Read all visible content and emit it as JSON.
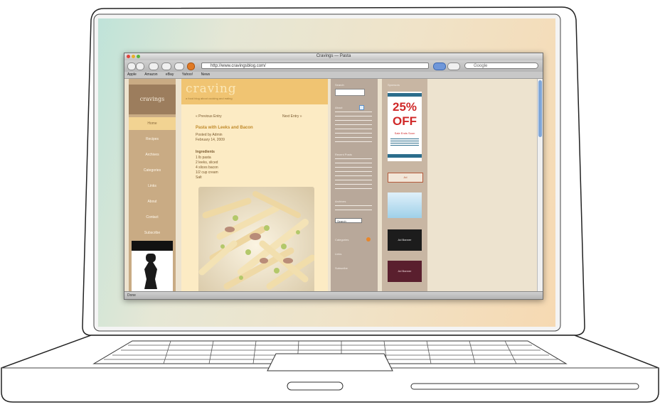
{
  "browser": {
    "window_title": "Cravings — Pasta",
    "url": "http://www.cravingsblog.com/",
    "search_placeholder": "Google",
    "bookmarks": [
      "Apple",
      "Amazon",
      "eBay",
      "Yahoo!",
      "News"
    ],
    "status": "Done"
  },
  "site": {
    "logo": "cravings",
    "brand": "craving",
    "tagline": "a food blog about cooking and eating",
    "nav": [
      "Home",
      "Recipes",
      "Archives",
      "Categories",
      "Links",
      "About",
      "Contact",
      "Subscribe"
    ],
    "breadcrumb_left": "« Previous Entry",
    "breadcrumb_right": "Next Entry »",
    "post_title": "Pasta with Leeks and Bacon",
    "post_meta": [
      "Posted by Admin",
      "February 14, 2009"
    ],
    "ingredients_title": "Ingredients",
    "ingredients": [
      "1 lb pasta",
      "2 leeks, sliced",
      "4 slices bacon",
      "1/2 cup cream",
      "Salt"
    ],
    "sidebar_search_label": "Search",
    "sidebar_sections": [
      "About",
      "Recent Posts",
      "Archives",
      "Categories",
      "Links",
      "Subscribe"
    ],
    "sidebar_input_value": "Search",
    "sponsor_header": "Sponsors",
    "ad_sale_big": "25%",
    "ad_sale_off": "OFF",
    "ad_sale_small": "Sale Ends Soon",
    "ad_bottom_text": "Ad",
    "ad_dark1": "Ad Banner",
    "ad_dark2": "Ad Banner"
  },
  "colors": {
    "accent": "#f0c472",
    "nav_bg": "#c9ab84",
    "ad_red": "#d02828"
  }
}
